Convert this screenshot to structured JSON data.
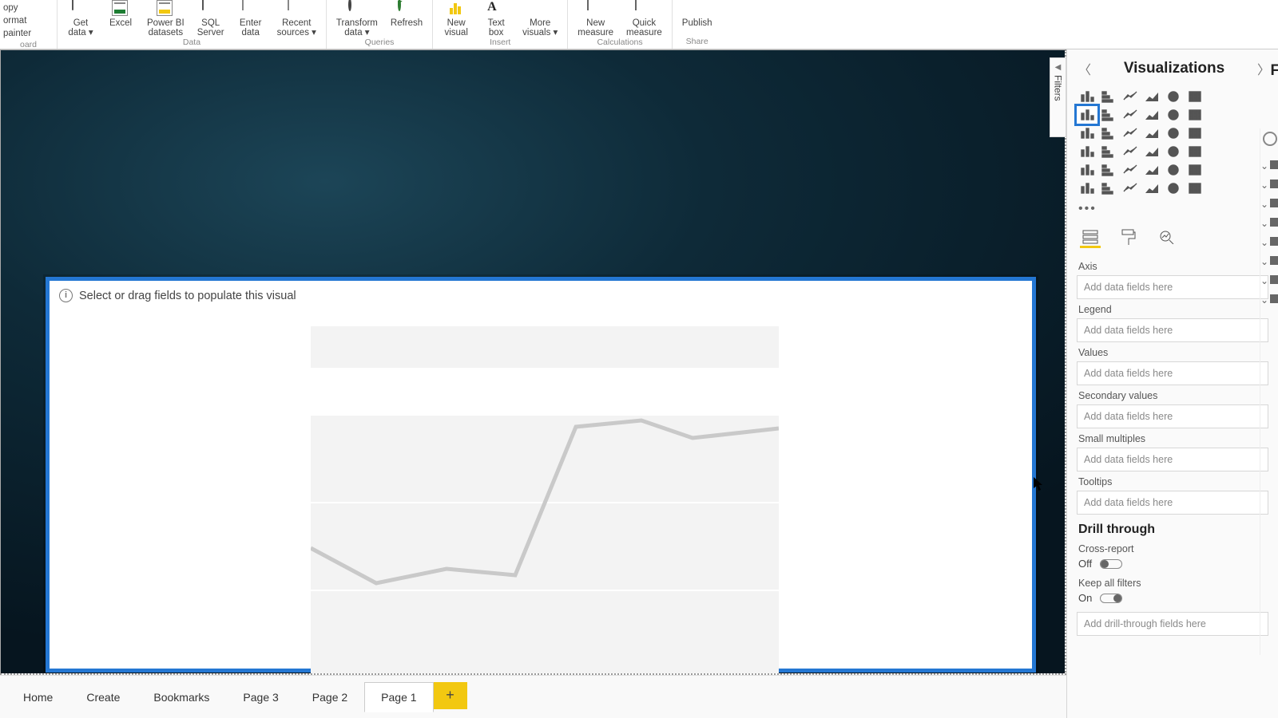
{
  "ribbon": {
    "clipboard": {
      "l1": "opy",
      "l2": "ormat painter",
      "cap": "oard"
    },
    "data": {
      "buttons": [
        {
          "id": "get-data",
          "label": "Get\ndata ▾"
        },
        {
          "id": "excel",
          "label": "Excel"
        },
        {
          "id": "powerbi-ds",
          "label": "Power BI\ndatasets"
        },
        {
          "id": "sql",
          "label": "SQL\nServer"
        },
        {
          "id": "enter",
          "label": "Enter\ndata"
        },
        {
          "id": "recent",
          "label": "Recent\nsources ▾"
        }
      ],
      "cap": "Data"
    },
    "queries": {
      "buttons": [
        {
          "id": "transform",
          "label": "Transform\ndata ▾"
        },
        {
          "id": "refresh",
          "label": "Refresh"
        }
      ],
      "cap": "Queries"
    },
    "insert": {
      "buttons": [
        {
          "id": "new-visual",
          "label": "New\nvisual"
        },
        {
          "id": "text-box",
          "label": "Text\nbox"
        },
        {
          "id": "more-visuals",
          "label": "More\nvisuals ▾"
        }
      ],
      "cap": "Insert"
    },
    "calc": {
      "buttons": [
        {
          "id": "new-measure",
          "label": "New\nmeasure"
        },
        {
          "id": "quick-measure",
          "label": "Quick\nmeasure"
        }
      ],
      "cap": "Calculations"
    },
    "share": {
      "buttons": [
        {
          "id": "publish",
          "label": "Publish"
        }
      ],
      "cap": "Share"
    }
  },
  "canvas": {
    "hint": "Select or drag fields to populate this visual"
  },
  "filters": {
    "label": "Filters"
  },
  "panel": {
    "title": "Visualizations",
    "fields_fragment": "Fie",
    "wells": [
      {
        "id": "axis",
        "label": "Axis",
        "ph": "Add data fields here"
      },
      {
        "id": "legend",
        "label": "Legend",
        "ph": "Add data fields here"
      },
      {
        "id": "values",
        "label": "Values",
        "ph": "Add data fields here"
      },
      {
        "id": "sec-values",
        "label": "Secondary values",
        "ph": "Add data fields here"
      },
      {
        "id": "small-mult",
        "label": "Small multiples",
        "ph": "Add data fields here"
      },
      {
        "id": "tooltips",
        "label": "Tooltips",
        "ph": "Add data fields here"
      }
    ],
    "drill": {
      "title": "Drill through",
      "cross_label": "Cross-report",
      "cross_state": "Off",
      "keep_label": "Keep all filters",
      "keep_state": "On",
      "add_ph": "Add drill-through fields here"
    }
  },
  "tabs": [
    {
      "id": "home",
      "label": "Home"
    },
    {
      "id": "create",
      "label": "Create"
    },
    {
      "id": "bookmarks",
      "label": "Bookmarks"
    },
    {
      "id": "page3",
      "label": "Page 3"
    },
    {
      "id": "page2",
      "label": "Page 2"
    },
    {
      "id": "page1",
      "label": "Page 1",
      "active": true
    }
  ]
}
